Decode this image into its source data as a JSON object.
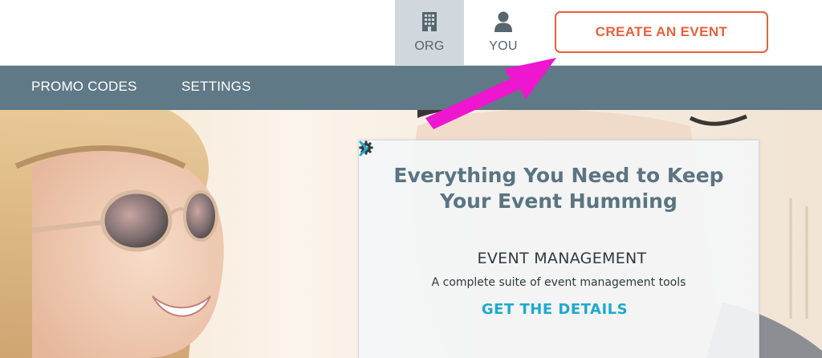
{
  "header": {
    "tabs": [
      {
        "label": "ORG",
        "icon": "building-icon",
        "active": true
      },
      {
        "label": "YOU",
        "icon": "user-icon",
        "active": false
      }
    ],
    "create_button": "CREATE AN EVENT"
  },
  "nav": {
    "items": [
      {
        "label": "PROMO CODES"
      },
      {
        "label": "SETTINGS"
      }
    ]
  },
  "hero": {
    "heading": "Everything You Need to Keep Your Event Humming",
    "feature": {
      "icon": "gear-icon",
      "title": "EVENT MANAGEMENT",
      "description": "A complete suite of event management tools",
      "link_label": "GET THE DETAILS",
      "link_icon": "chevron-right-icon"
    }
  },
  "colors": {
    "accent": "#e8613c",
    "nav_bg": "#5f7986",
    "link": "#1ea9cf",
    "heading": "#5a7482",
    "annotation_arrow": "#ee16cf"
  }
}
